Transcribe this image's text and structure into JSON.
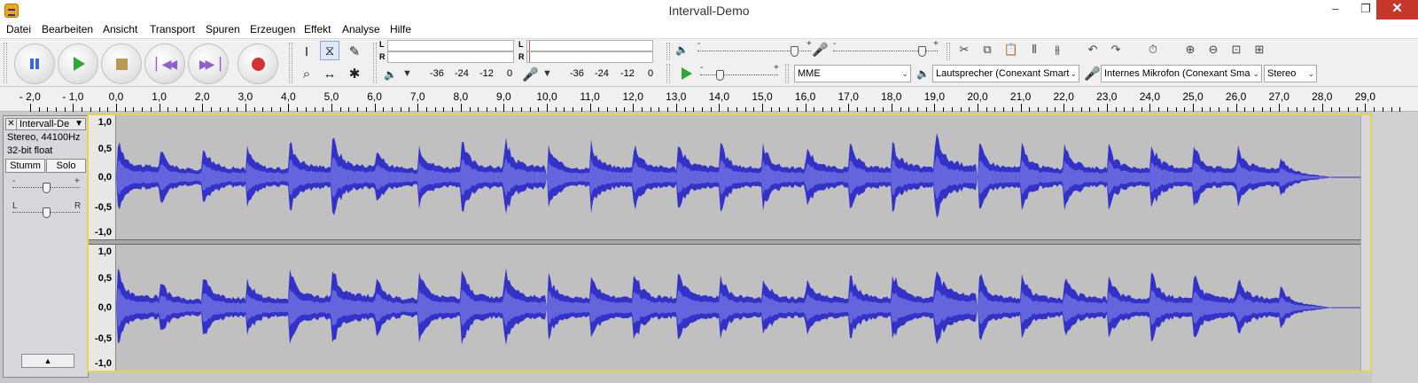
{
  "window": {
    "title": "Intervall-Demo",
    "minimize_glyph": "–",
    "restore_glyph": "❐",
    "close_glyph": "✕"
  },
  "menu": [
    "Datei",
    "Bearbeiten",
    "Ansicht",
    "Transport",
    "Spuren",
    "Erzeugen",
    "Effekt",
    "Analyse",
    "Hilfe"
  ],
  "meters": {
    "channel_left": "L",
    "channel_right": "R",
    "playback_scale": [
      "-36",
      "-24",
      "-12",
      "0"
    ],
    "record_scale": [
      "-36",
      "-24",
      "-12",
      "0"
    ]
  },
  "mixer": {
    "minus": "-",
    "plus": "+",
    "playback_volume": 0.85,
    "recording_volume": 0.85,
    "play_speed": 0.25
  },
  "device": {
    "host": "MME",
    "output": "Lautsprecher (Conexant Smart",
    "input": "Internes Mikrofon (Conexant Sma",
    "channels": "Stereo"
  },
  "ruler": {
    "labels": [
      "- 2,0",
      "- 1,0",
      "0,0",
      "1,0",
      "2,0",
      "3,0",
      "4,0",
      "5,0",
      "6,0",
      "7,0",
      "8,0",
      "9,0",
      "10,0",
      "11,0",
      "12,0",
      "13,0",
      "14,0",
      "15,0",
      "16,0",
      "17,0",
      "18,0",
      "19,0",
      "20,0",
      "21,0",
      "22,0",
      "23,0",
      "24,0",
      "25,0",
      "26,0",
      "27,0",
      "28,0",
      "29,0"
    ]
  },
  "track": {
    "name": "Intervall-De",
    "close_glyph": "✕",
    "menu_glyph": "▼",
    "format": "Stereo, 44100Hz",
    "bit_depth": "32-bit float",
    "mute_label": "Stumm",
    "solo_label": "Solo",
    "gain_minus": "-",
    "gain_plus": "+",
    "pan_left": "L",
    "pan_right": "R",
    "gain_value": 0.5,
    "pan_value": 0.5,
    "collapse_glyph": "▲",
    "amplitude_labels": [
      "1,0",
      "0,5",
      "0,0",
      "-0,5",
      "-1,0"
    ],
    "clip_end_seconds": 28.2,
    "note_onsets_seconds": [
      0.0,
      1.0,
      2.0,
      3.0,
      4.0,
      5.0,
      6.0,
      7.0,
      8.0,
      9.0,
      10.0,
      11.0,
      12.0,
      13.0,
      14.0,
      15.0,
      16.0,
      17.0,
      18.0,
      19.0,
      20.0,
      21.0,
      22.0,
      23.0,
      24.0,
      25.0,
      26.0,
      27.0
    ],
    "note_peaks": [
      0.85,
      0.62,
      0.72,
      0.68,
      0.84,
      0.9,
      0.68,
      0.75,
      0.8,
      0.85,
      0.72,
      0.76,
      0.78,
      0.82,
      0.75,
      0.72,
      0.75,
      0.76,
      0.78,
      0.98,
      0.78,
      0.72,
      0.75,
      0.72,
      0.76,
      0.72,
      0.72,
      0.55
    ]
  },
  "colors": {
    "waveform_peak": "#3232c8",
    "waveform_rms": "#6464dc",
    "track_background": "#c0c0c0",
    "selected_border": "#e8d44a"
  }
}
